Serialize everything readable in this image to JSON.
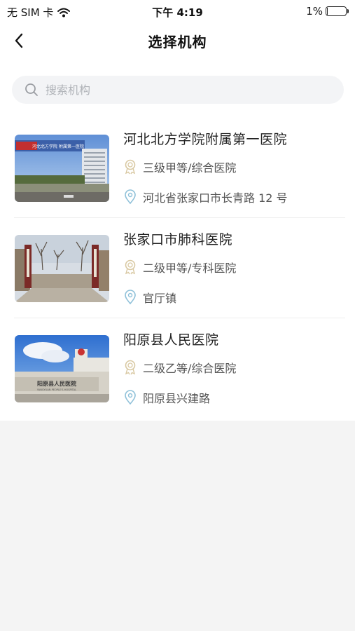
{
  "status_bar": {
    "carrier": "无 SIM 卡",
    "time": "下午 4:19",
    "battery": "1%",
    "battery_level": 0.01
  },
  "nav": {
    "title": "选择机构",
    "back_icon": "chevron-left-icon"
  },
  "search": {
    "placeholder": "搜索机构",
    "value": ""
  },
  "institutions": [
    {
      "name": "河北北方学院附属第一医院",
      "level": "三级甲等/综合医院",
      "address": "河北省张家口市长青路 12 号",
      "photo_sign": "河北北方学院 附属第一医院"
    },
    {
      "name": "张家口市肺科医院",
      "level": "二级甲等/专科医院",
      "address": "官厅镇"
    },
    {
      "name": "阳原县人民医院",
      "level": "二级乙等/综合医院",
      "address": "阳原县兴建路",
      "photo_sign": "阳原县人民医院",
      "photo_sign_en": "YANGYUAN PEOPLE'S HOSPITAL"
    }
  ],
  "colors": {
    "background": "#f4f4f4",
    "card": "#ffffff",
    "icon_medal": "#d9c9a3",
    "icon_location": "#8fc1d9"
  }
}
